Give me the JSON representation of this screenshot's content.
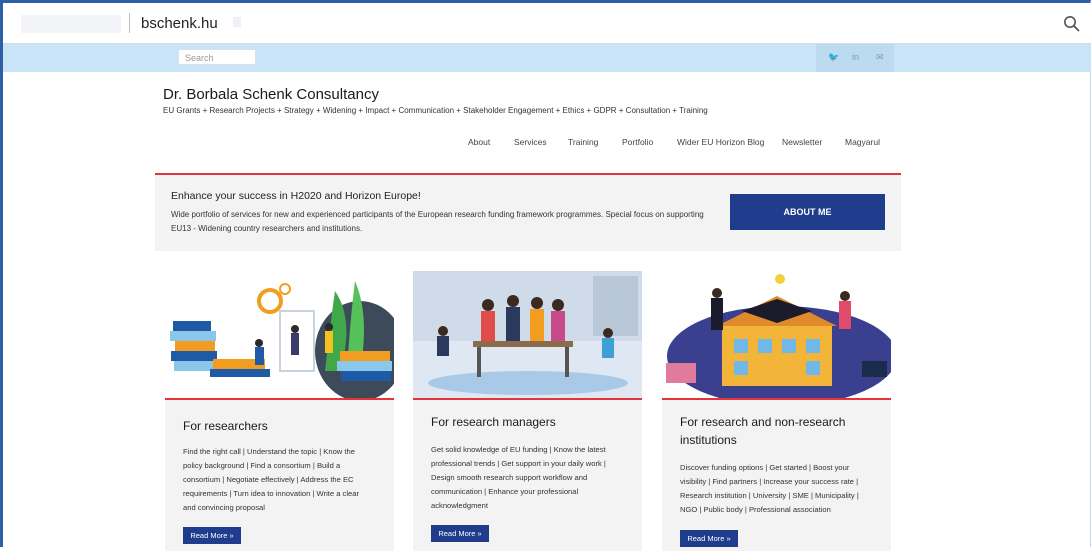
{
  "browser": {
    "url": "bschenk.hu"
  },
  "topbar": {
    "search_placeholder": "Search",
    "social": [
      {
        "icon": "twitter-icon",
        "glyph": "🐦"
      },
      {
        "icon": "linkedin-icon",
        "glyph": "in"
      },
      {
        "icon": "email-icon",
        "glyph": "✉"
      }
    ]
  },
  "brand": {
    "title": "Dr. Borbala Schenk Consultancy",
    "tagline": "EU Grants + Research Projects + Strategy + Widening + Impact + Communication + Stakeholder Engagement + Ethics + GDPR + Consultation + Training"
  },
  "nav": [
    "About",
    "Services",
    "Training",
    "Portfolio",
    "Wider EU Horizon Blog",
    "Newsletter",
    "Magyarul"
  ],
  "hero": {
    "heading": "Enhance your success in H2020 and Horizon Europe!",
    "body": "Wide portfolio of services for new and experienced participants of the European research funding framework programmes. Special focus on supporting EU13 - Widening country researchers and institutions.",
    "button": "ABOUT ME"
  },
  "cards": [
    {
      "title": "For researchers",
      "text": "Find the right call | Understand the topic | Know the policy background | Find a consortium | Build a consortium | Negotiate effectively | Address the EC requirements | Turn idea to innovation | Write a clear and convincing proposal",
      "button": "Read More »"
    },
    {
      "title": "For research managers",
      "text": "Get solid knowledge of EU funding | Know the latest professional trends | Get support in your daily work | Design smooth research support workflow and communication | Enhance your professional acknowledgment",
      "button": "Read More »"
    },
    {
      "title": "For research and non-research institutions",
      "text": "Discover funding options | Get started | Boost your visibility | Find partners | Increase your success rate | Research institution | University | SME | Municipality | NGO | Public body | Professional association",
      "button": "Read More »"
    }
  ],
  "colors": {
    "accent_red": "#e2343a",
    "navy": "#1f3d8c",
    "topbar": "#c8e4f6"
  }
}
